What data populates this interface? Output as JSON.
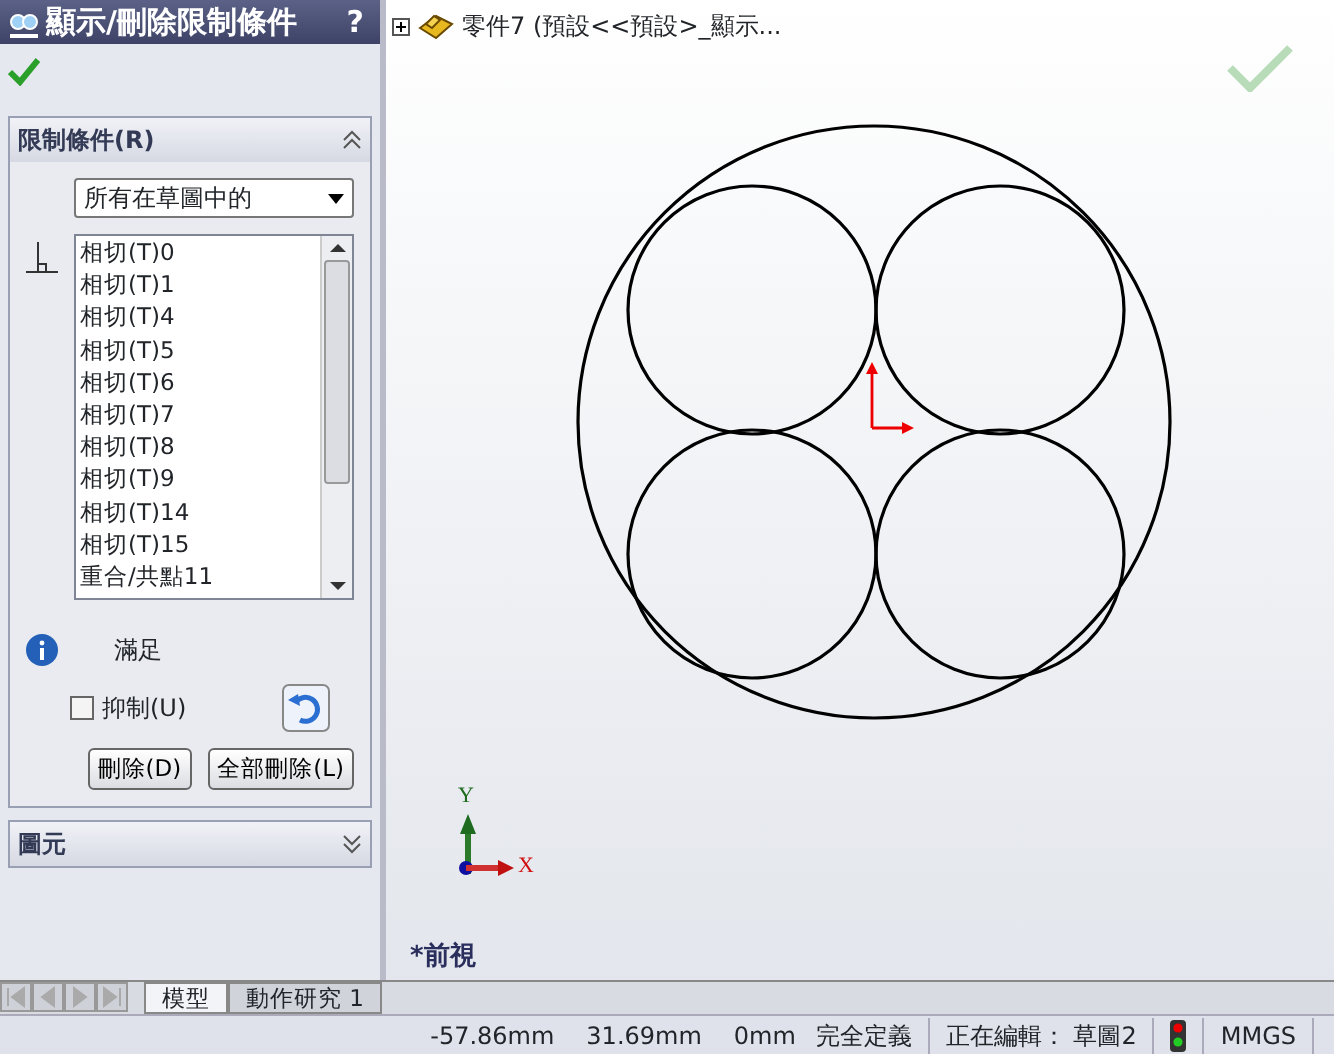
{
  "panel": {
    "title": "顯示/刪除限制條件",
    "help": "?",
    "relations_section": {
      "title": "限制條件(R)",
      "expanded": true,
      "filter": "所有在草圖中的",
      "items": [
        {
          "text": "相切(T)0",
          "selected": false
        },
        {
          "text": "相切(T)1",
          "selected": false
        },
        {
          "text": "相切(T)4",
          "selected": false
        },
        {
          "text": "相切(T)5",
          "selected": false
        },
        {
          "text": "相切(T)6",
          "selected": false
        },
        {
          "text": "相切(T)7",
          "selected": false
        },
        {
          "text": "相切(T)8",
          "selected": false
        },
        {
          "text": "相切(T)9",
          "selected": false
        },
        {
          "text": "相切(T)14",
          "selected": false
        },
        {
          "text": "相切(T)15",
          "selected": false
        },
        {
          "text": "重合/共點11",
          "selected": false
        }
      ],
      "status": "滿足",
      "suppress": {
        "label": "抑制(U)",
        "checked": false
      },
      "buttons": [
        "刪除(D)",
        "全部刪除(L)"
      ]
    },
    "entities_section": {
      "title": "圖元",
      "expanded": false
    }
  },
  "graphics": {
    "tree_label": "零件7  (預設<<預設>_顯示...",
    "view_name": "*前視",
    "axis_labels": [
      "Y",
      "X"
    ]
  },
  "bottom_tabs": [
    {
      "label": "模型",
      "selected": true
    },
    {
      "label": "動作研究 1",
      "selected": false
    }
  ],
  "status_bar": [
    "-57.86mm",
    "31.69mm",
    "0mm",
    "完全定義",
    "正在編輯： 草圖2",
    "MMGS"
  ]
}
